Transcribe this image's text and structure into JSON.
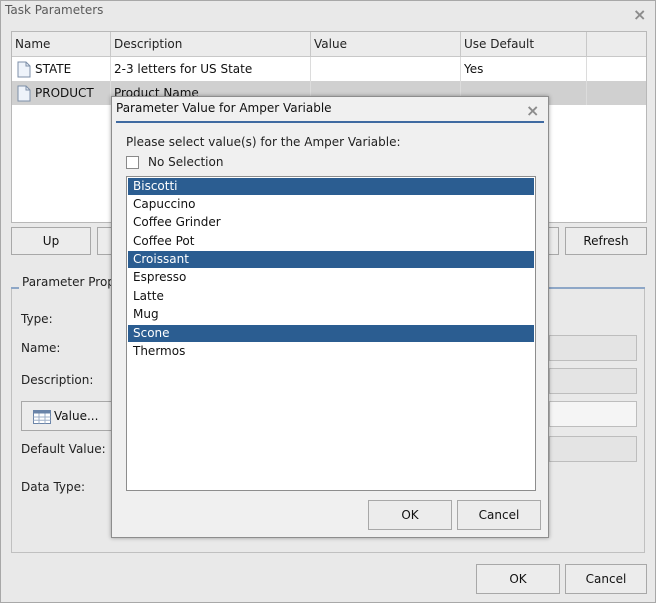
{
  "window": {
    "title": "Task Parameters",
    "close_icon": "close-icon"
  },
  "grid": {
    "columns": [
      "Name",
      "Description",
      "Value",
      "Use Default",
      ""
    ],
    "rows": [
      {
        "name": "STATE",
        "description": "2-3 letters for US State",
        "value": "",
        "use_default": "Yes",
        "icon": "document-icon"
      },
      {
        "name": "PRODUCT",
        "description": "Product Name",
        "value": "",
        "use_default": "",
        "icon": "document-icon"
      }
    ]
  },
  "buttons": {
    "up": "Up",
    "refresh": "Refresh",
    "ok": "OK",
    "cancel": "Cancel"
  },
  "properties": {
    "title": "Parameter Prop",
    "type_label": "Type:",
    "name_label": "Name:",
    "description_label": "Description:",
    "value_button": "Value...",
    "default_value_label": "Default Value:",
    "data_type_label": "Data Type:"
  },
  "dialog": {
    "title": "Parameter Value for Amper Variable",
    "prompt": "Please select value(s) for the Amper Variable:",
    "no_selection": "No Selection",
    "ok": "OK",
    "cancel": "Cancel",
    "items": [
      {
        "label": "Biscotti",
        "selected": true
      },
      {
        "label": "Capuccino",
        "selected": false
      },
      {
        "label": "Coffee Grinder",
        "selected": false
      },
      {
        "label": "Coffee Pot",
        "selected": false
      },
      {
        "label": "Croissant",
        "selected": true
      },
      {
        "label": "Espresso",
        "selected": false
      },
      {
        "label": "Latte",
        "selected": false
      },
      {
        "label": "Mug",
        "selected": false
      },
      {
        "label": "Scone",
        "selected": true
      },
      {
        "label": "Thermos",
        "selected": false
      }
    ]
  },
  "colors": {
    "selection": "#2b5d91",
    "accent_line": "#3f6aa1",
    "row_highlight": "#d0d0d0"
  }
}
